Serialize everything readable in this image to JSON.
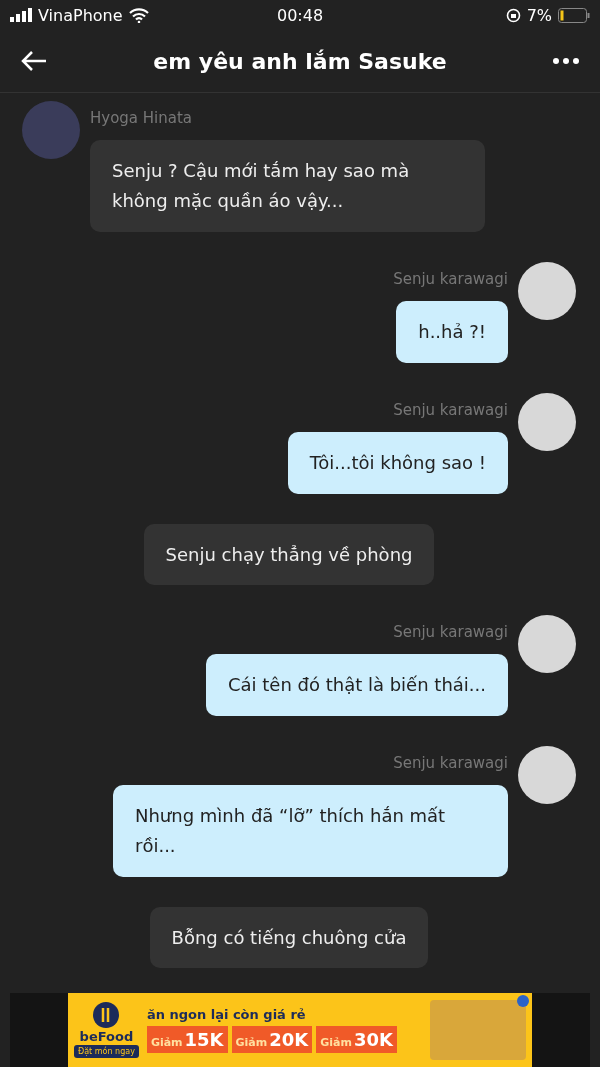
{
  "status_bar": {
    "carrier": "VinaPhone",
    "time": "00:48",
    "battery": "7%"
  },
  "header": {
    "title": "em yêu anh lắm Sasuke"
  },
  "messages": [
    {
      "kind": "incoming",
      "sender": "Hyoga Hinata",
      "text": "Senju ? Cậu mới tắm hay sao mà không mặc quần áo vậy..."
    },
    {
      "kind": "outgoing",
      "sender": "Senju karawagi",
      "text": "h..hả ?!"
    },
    {
      "kind": "outgoing",
      "sender": "Senju karawagi",
      "text": "Tôi...tôi không sao !"
    },
    {
      "kind": "narration",
      "text": "Senju chạy thẳng về phòng"
    },
    {
      "kind": "outgoing",
      "sender": "Senju karawagi",
      "text": "Cái tên đó thật là biến thái..."
    },
    {
      "kind": "outgoing",
      "sender": "Senju karawagi",
      "text": "Nhưng mình đã “lỡ” thích hắn mất rồi..."
    },
    {
      "kind": "narration",
      "text": "Bỗng có tiếng chuông cửa"
    }
  ],
  "ad": {
    "brand": "beFood",
    "cta": "Đặt món ngay",
    "headline": "ăn ngon lại còn giá rẻ",
    "offers": [
      {
        "label": "Giảm",
        "amount": "15K"
      },
      {
        "label": "Giảm",
        "amount": "20K"
      },
      {
        "label": "Giảm",
        "amount": "30K"
      }
    ]
  }
}
